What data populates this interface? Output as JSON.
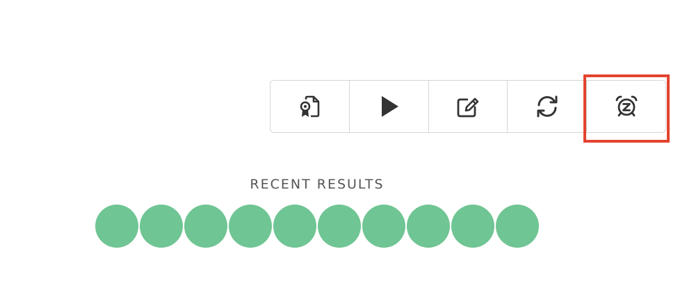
{
  "toolbar": {
    "buttons": [
      {
        "icon": "certificate-file-icon"
      },
      {
        "icon": "play-icon"
      },
      {
        "icon": "edit-icon"
      },
      {
        "icon": "refresh-icon"
      },
      {
        "icon": "snooze-alarm-icon",
        "highlighted": true
      }
    ]
  },
  "results": {
    "title": "RECENT RESULTS",
    "items": [
      "pass",
      "pass",
      "pass",
      "pass",
      "pass",
      "pass",
      "pass",
      "pass",
      "pass",
      "pass"
    ],
    "pass_color": "#6fc593"
  },
  "colors": {
    "icon": "#333333",
    "border": "#d6d6d6",
    "highlight": "#e3432f"
  }
}
